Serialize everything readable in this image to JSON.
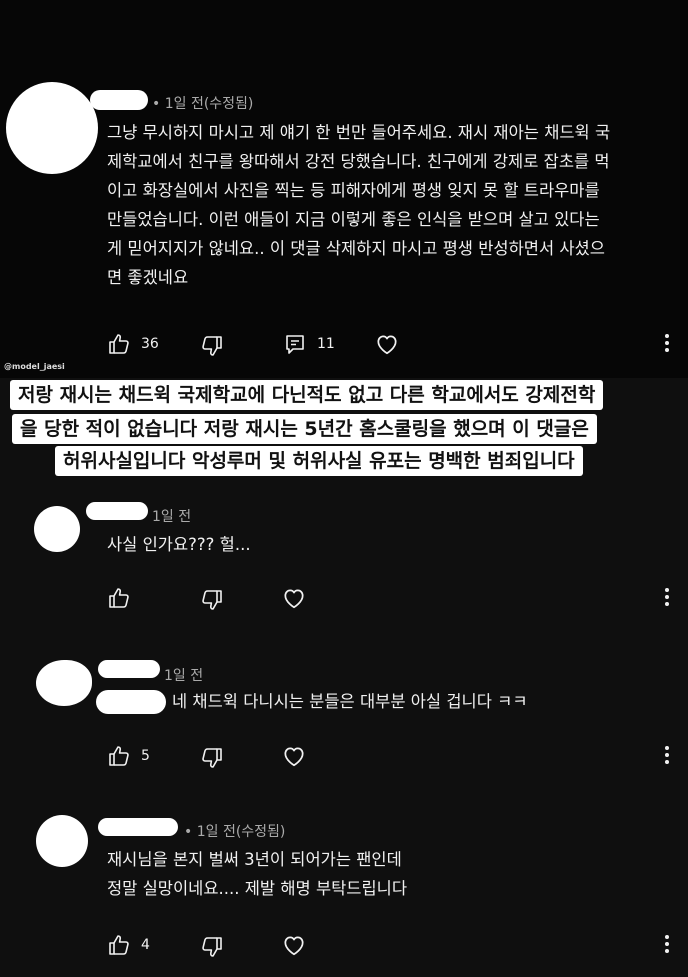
{
  "comments": [
    {
      "meta": "• 1일 전(수정됨)",
      "lines": [
        "그냥 무시하지 마시고 제 얘기 한 번만 들어주세요. 재시 재아는 채드윅 국",
        "제학교에서 친구를 왕따해서 강전 당했습니다. 친구에게 강제로 잡초를 먹",
        "이고 화장실에서 사진을 찍는 등 피해자에게 평생 잊지 못 할 트라우마를",
        "만들었습니다. 이런 애들이 지금 이렇게 좋은 인식을 받으며 살고 있다는",
        "게 믿어지지가 않네요.. 이 댓글 삭제하지 마시고 평생 반성하면서 사셨으",
        "면 좋겠네요"
      ],
      "likes": "36",
      "replies": "11"
    },
    {
      "meta": "1일 전",
      "lines": [
        "사실 인가요??? 헐..."
      ],
      "likes": ""
    },
    {
      "meta": "1일 전",
      "lines": [
        "네 채드윅 다니시는 분들은 대부분 아실 겁니다 ㅋㅋ"
      ],
      "likes": "5"
    },
    {
      "meta": "• 1일 전(수정됨)",
      "lines": [
        "재시님을 본지 벌써 3년이 되어가는 팬인데",
        "정말 실망이네요.... 제발 해명 부탁드립니다"
      ],
      "likes": "4"
    }
  ],
  "watermark": "@model_jaesi",
  "banner": [
    "저랑 재시는 채드윅 국제학교에 다닌적도 없고 다른 학교에서도 강제전학",
    "을 당한 적이 없습니다 저랑 재시는 5년간 홈스쿨링을 했으며 이 댓글은",
    "허위사실입니다 악성루머 및 허위사실 유포는 명백한 범죄입니다"
  ]
}
